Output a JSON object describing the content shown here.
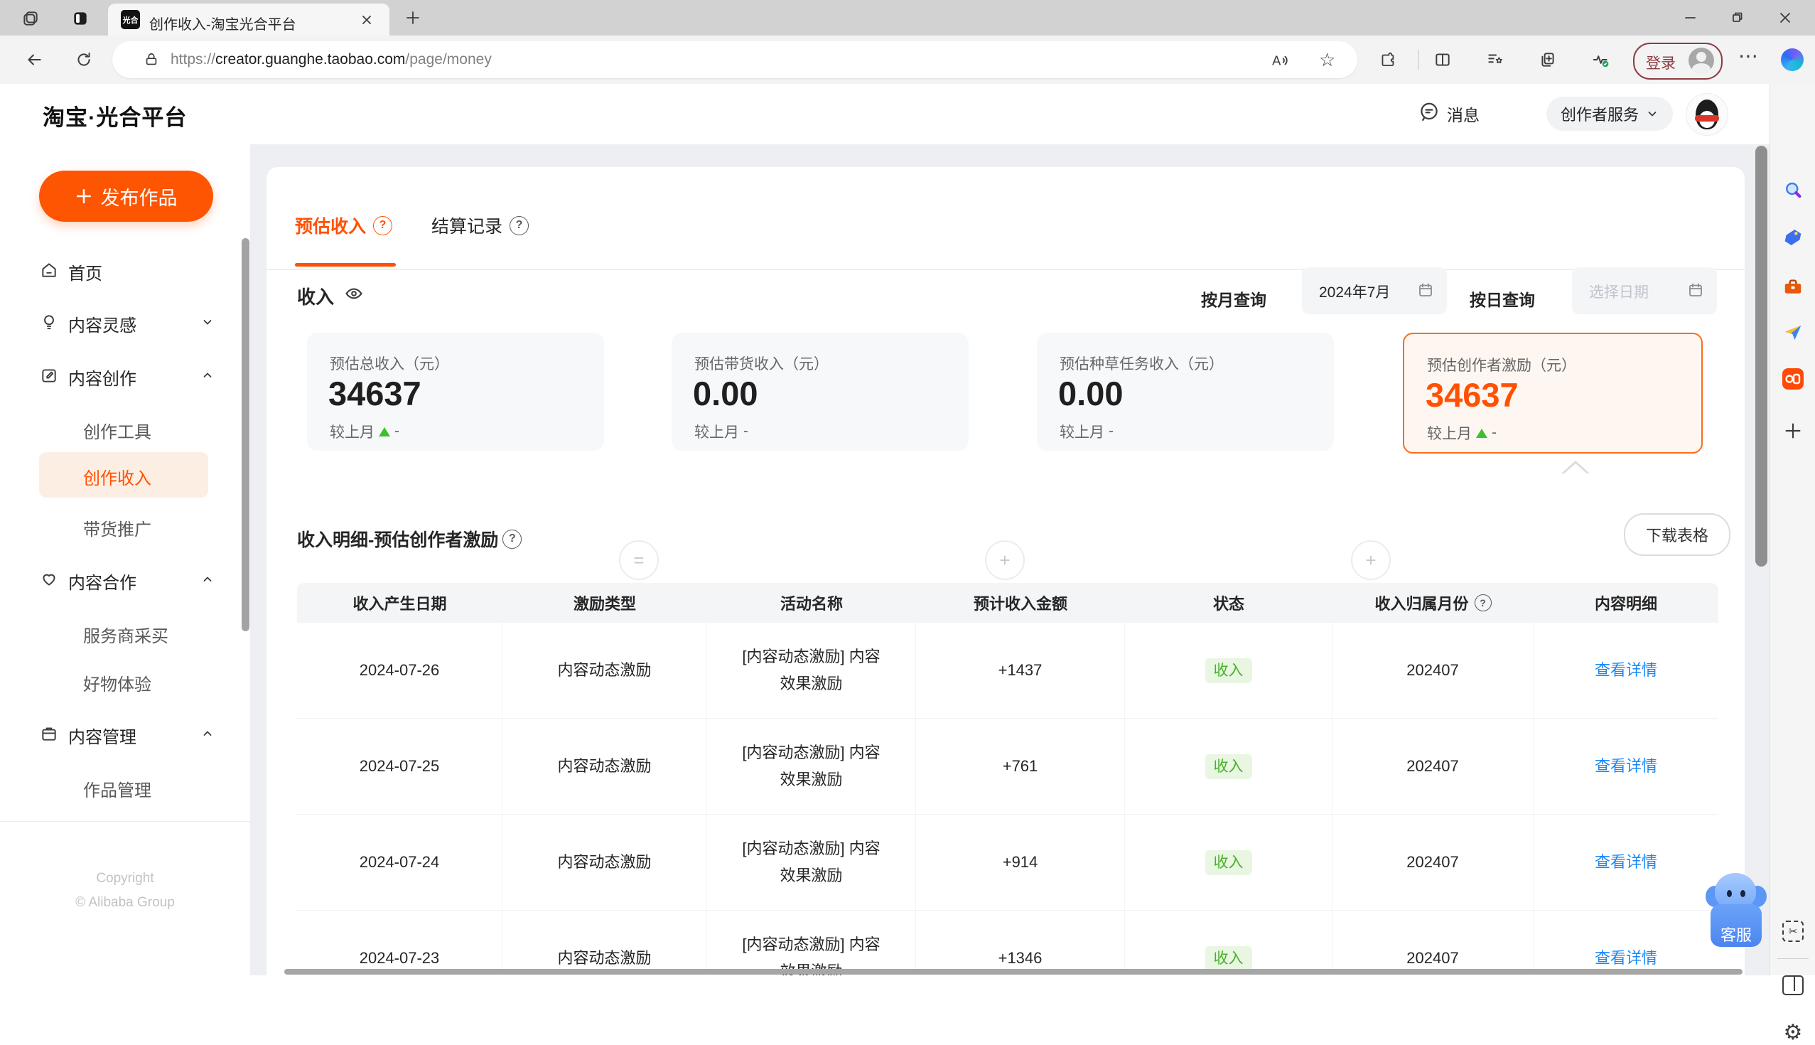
{
  "browser": {
    "tab_title": "创作收入-淘宝光合平台",
    "favicon_text": "光合",
    "url_scheme": "https://",
    "url_host": "creator.guanghe.taobao.com",
    "url_path": "/page/money",
    "login_label": "登录"
  },
  "icons": {
    "star": "☆",
    "more": "⋯",
    "gear": "⚙",
    "scissors": "✂",
    "plus": "+"
  },
  "header": {
    "logo": "淘宝·光合平台",
    "messages": "消息",
    "service_menu": "创作者服务"
  },
  "sidebar": {
    "publish_button": "发布作品",
    "items": {
      "home": "首页",
      "inspiration": "内容灵感",
      "creation": "内容创作",
      "creation_tools": "创作工具",
      "creation_income": "创作收入",
      "promotion": "带货推广",
      "cooperation": "内容合作",
      "service_purchase": "服务商采买",
      "goods_experience": "好物体验",
      "management": "内容管理",
      "works_management": "作品管理"
    },
    "copyright_line1": "Copyright",
    "copyright_line2": "© Alibaba Group"
  },
  "main": {
    "tabs": {
      "estimated": "预估收入",
      "settlement": "结算记录"
    },
    "income_title": "收入",
    "month_query_label": "按月查询",
    "month_query_value": "2024年7月",
    "day_query_label": "按日查询",
    "day_query_placeholder": "选择日期",
    "cards": [
      {
        "label": "预估总收入（元）",
        "value": "34637",
        "compare": "较上月",
        "delta": "-"
      },
      {
        "label": "预估带货收入（元）",
        "value": "0.00",
        "compare": "较上月",
        "delta": "-"
      },
      {
        "label": "预估种草任务收入（元）",
        "value": "0.00",
        "compare": "较上月",
        "delta": "-"
      },
      {
        "label": "预估创作者激励（元）",
        "value": "34637",
        "compare": "较上月",
        "delta": "-"
      }
    ],
    "operators": {
      "op1": "=",
      "op2": "+",
      "op3": "+"
    },
    "detail_title": "收入明细-预估创作者激励",
    "download_button": "下载表格",
    "table": {
      "headers": [
        "收入产生日期",
        "激励类型",
        "活动名称",
        "预计收入金额",
        "状态",
        "收入归属月份",
        "内容明细"
      ],
      "rows": [
        {
          "date": "2024-07-26",
          "type": "内容动态激励",
          "activity": "[内容动态激励] 内容效果激励",
          "amount": "+1437",
          "status": "收入",
          "month": "202407",
          "action": "查看详情"
        },
        {
          "date": "2024-07-25",
          "type": "内容动态激励",
          "activity": "[内容动态激励] 内容效果激励",
          "amount": "+761",
          "status": "收入",
          "month": "202407",
          "action": "查看详情"
        },
        {
          "date": "2024-07-24",
          "type": "内容动态激励",
          "activity": "[内容动态激励] 内容效果激励",
          "amount": "+914",
          "status": "收入",
          "month": "202407",
          "action": "查看详情"
        },
        {
          "date": "2024-07-23",
          "type": "内容动态激励",
          "activity": "[内容动态激励] 内容效果激励",
          "amount": "+1346",
          "status": "收入",
          "month": "202407",
          "action": "查看详情"
        }
      ]
    }
  },
  "widgets": {
    "kefu": "客服"
  },
  "colors": {
    "accent": "#ff5103",
    "active_card_border": "#ff6b1a",
    "green": "#47b22a",
    "link": "#1b87f8",
    "login_red": "#8d3c43"
  }
}
